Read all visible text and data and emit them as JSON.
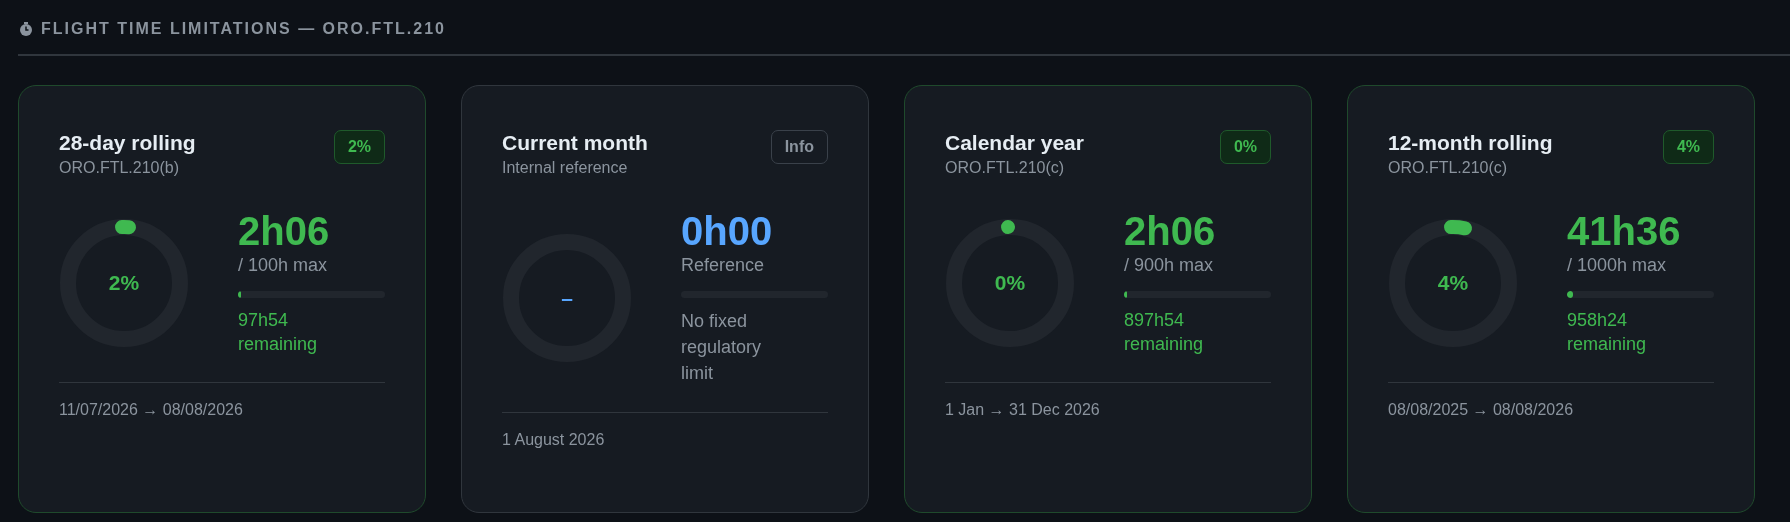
{
  "section": {
    "title": "FLIGHT TIME LIMITATIONS — ORO.FTL.210"
  },
  "cards": [
    {
      "kind": "limit",
      "title": "28-day rolling",
      "subtitle": "ORO.FTL.210(b)",
      "badge": "2%",
      "gauge_label": "2%",
      "level": 0.02,
      "value": "2h06",
      "caption": "/ 100h max",
      "remaining_value": "97h54",
      "remaining_label": "remaining",
      "footer": "11/07/2026 → 08/08/2026"
    },
    {
      "kind": "reference",
      "title": "Current month",
      "subtitle": "Internal reference",
      "badge": "Info",
      "gauge_label": "–",
      "value": "0h00",
      "caption": "Reference",
      "note": "No fixed regulatory limit",
      "footer": "1 August 2026"
    },
    {
      "kind": "limit",
      "title": "Calendar year",
      "subtitle": "ORO.FTL.210(c)",
      "badge": "0%",
      "gauge_label": "0%",
      "level": 0,
      "value": "2h06",
      "caption": "/ 900h max",
      "remaining_value": "897h54",
      "remaining_label": "remaining",
      "footer": "1 Jan → 31 Dec 2026"
    },
    {
      "kind": "limit",
      "title": "12-month rolling",
      "subtitle": "ORO.FTL.210(c)",
      "badge": "4%",
      "gauge_label": "4%",
      "level": 0.04,
      "value": "41h36",
      "caption": "/ 1000h max",
      "remaining_value": "958h24",
      "remaining_label": "remaining",
      "footer": "08/08/2025 → 08/08/2026"
    }
  ]
}
